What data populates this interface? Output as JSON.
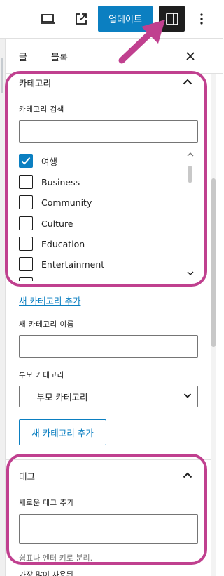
{
  "toolbar": {
    "update_label": "업데이트",
    "preview_icon": "laptop-icon",
    "external_icon": "external-link-icon",
    "sidebar_icon": "sidebar-toggle-icon",
    "more_icon": "more-vertical-icon"
  },
  "tabs": [
    {
      "label": "글"
    },
    {
      "label": "블록"
    }
  ],
  "categories_panel": {
    "title": "카테고리",
    "search_label": "카테고리 검색",
    "search_value": "",
    "items": [
      {
        "label": "여행",
        "checked": true
      },
      {
        "label": "Business",
        "checked": false
      },
      {
        "label": "Community",
        "checked": false
      },
      {
        "label": "Culture",
        "checked": false
      },
      {
        "label": "Education",
        "checked": false
      },
      {
        "label": "Entertainment",
        "checked": false
      }
    ],
    "add_link": "새 카테고리 추가",
    "new_name_label": "새 카테고리 이름",
    "new_name_value": "",
    "parent_label": "부모 카테고리",
    "parent_selected": "— 부모 카테고리 —",
    "add_button": "새 카테고리 추가"
  },
  "tags_panel": {
    "title": "태그",
    "add_label": "새로운 태그 추가",
    "input_value": "",
    "help": "쉼표나 엔터 키로 분리.",
    "below_cut": "가장 많이 사용된"
  },
  "colors": {
    "accent": "#0b7fc1",
    "highlight": "#c0408f",
    "dark": "#1e1e1e"
  }
}
